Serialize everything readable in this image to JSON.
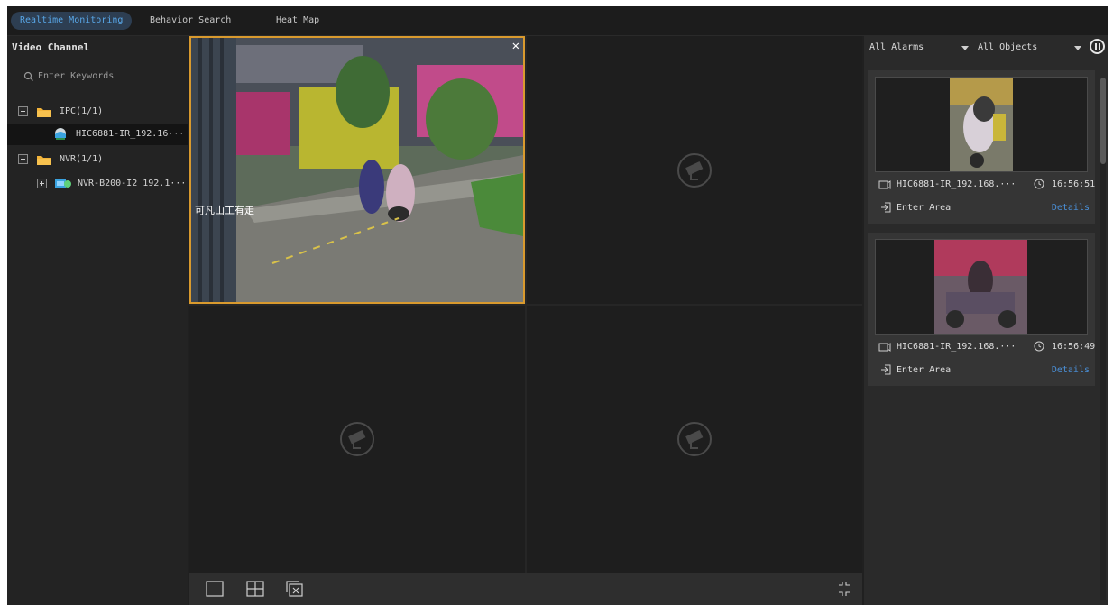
{
  "tabs": [
    {
      "label": "Realtime Monitoring",
      "active": true
    },
    {
      "label": "Behavior Search",
      "active": false
    },
    {
      "label": "Heat Map",
      "active": false
    }
  ],
  "left_panel": {
    "title": "Video Channel",
    "search_placeholder": "Enter Keywords",
    "tree": [
      {
        "label": "IPC(1/1)",
        "type": "group",
        "expanded": true
      },
      {
        "label": "HIC6881-IR_192.16···",
        "type": "camera",
        "selected": true
      },
      {
        "label": "NVR(1/1)",
        "type": "group",
        "expanded": true
      },
      {
        "label": "NVR-B200-I2_192.1···",
        "type": "device",
        "expanded": false
      }
    ]
  },
  "video": {
    "active_window": 1,
    "overlay_text": "可凡山工有走"
  },
  "right_panel": {
    "alarm_filter": "All Alarms",
    "object_filter": "All Objects",
    "events": [
      {
        "camera": "HIC6881-IR_192.168.···",
        "time": "16:56:51",
        "event": "Enter Area",
        "details_label": "Details"
      },
      {
        "camera": "HIC6881-IR_192.168.···",
        "time": "16:56:49",
        "event": "Enter Area",
        "details_label": "Details"
      }
    ]
  },
  "colors": {
    "accent": "#58a6e6",
    "active_border": "#d99a2e",
    "link": "#4a90d9"
  },
  "icons": {
    "camera_placeholder": "camera-offline-icon",
    "pause": "pause-icon"
  }
}
